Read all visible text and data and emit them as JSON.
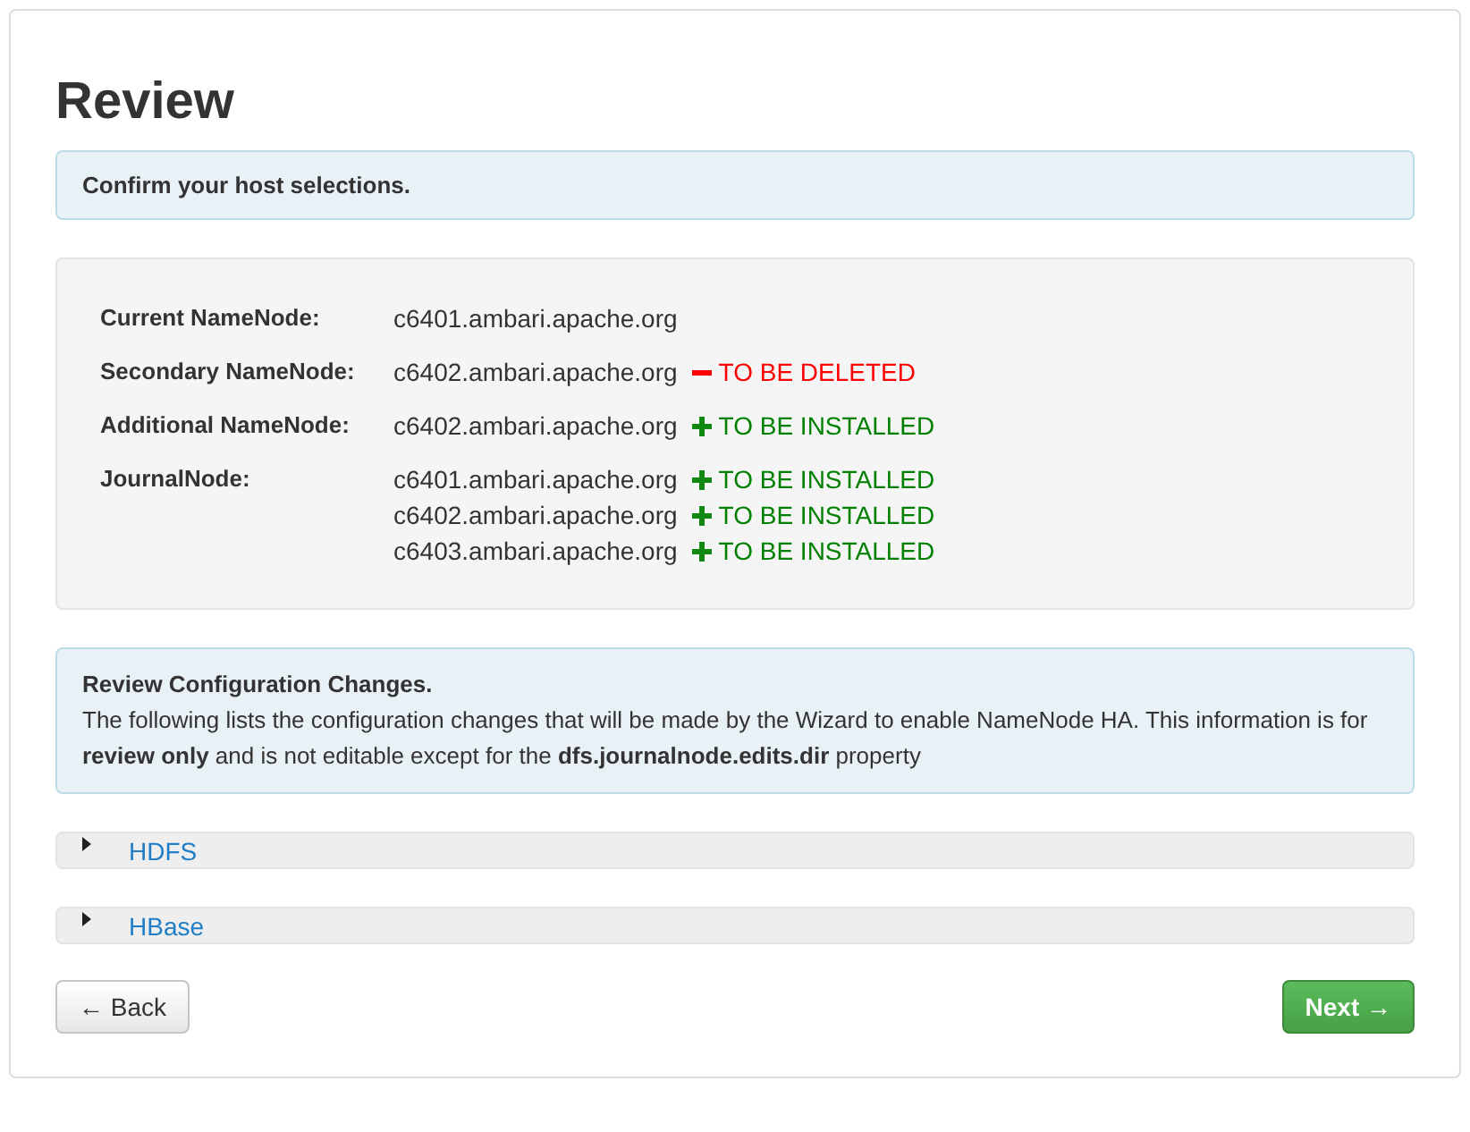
{
  "title": "Review",
  "notice": "Confirm your host selections.",
  "hosts": [
    {
      "role": "Current NameNode:",
      "entries": [
        {
          "host": "c6401.ambari.apache.org"
        }
      ]
    },
    {
      "role": "Secondary NameNode:",
      "entries": [
        {
          "host": "c6402.ambari.apache.org",
          "status": {
            "kind": "delete",
            "label": "TO BE DELETED"
          }
        }
      ]
    },
    {
      "role": "Additional NameNode:",
      "entries": [
        {
          "host": "c6402.ambari.apache.org",
          "status": {
            "kind": "install",
            "label": "TO BE INSTALLED"
          }
        }
      ]
    },
    {
      "role": "JournalNode:",
      "entries": [
        {
          "host": "c6401.ambari.apache.org",
          "status": {
            "kind": "install",
            "label": "TO BE INSTALLED"
          }
        },
        {
          "host": "c6402.ambari.apache.org",
          "status": {
            "kind": "install",
            "label": "TO BE INSTALLED"
          }
        },
        {
          "host": "c6403.ambari.apache.org",
          "status": {
            "kind": "install",
            "label": "TO BE INSTALLED"
          }
        }
      ]
    }
  ],
  "config_notice": {
    "heading": "Review Configuration Changes.",
    "text": "The following lists the configuration changes that will be made by the Wizard to enable NameNode HA. This information is for **review only** and is not editable except for the **dfs.journalnode.edits.dir** property"
  },
  "sections": [
    {
      "label": "HDFS",
      "expanded": false
    },
    {
      "label": "HBase",
      "expanded": false
    }
  ],
  "buttons": {
    "back": "← Back",
    "next": "Next →"
  }
}
